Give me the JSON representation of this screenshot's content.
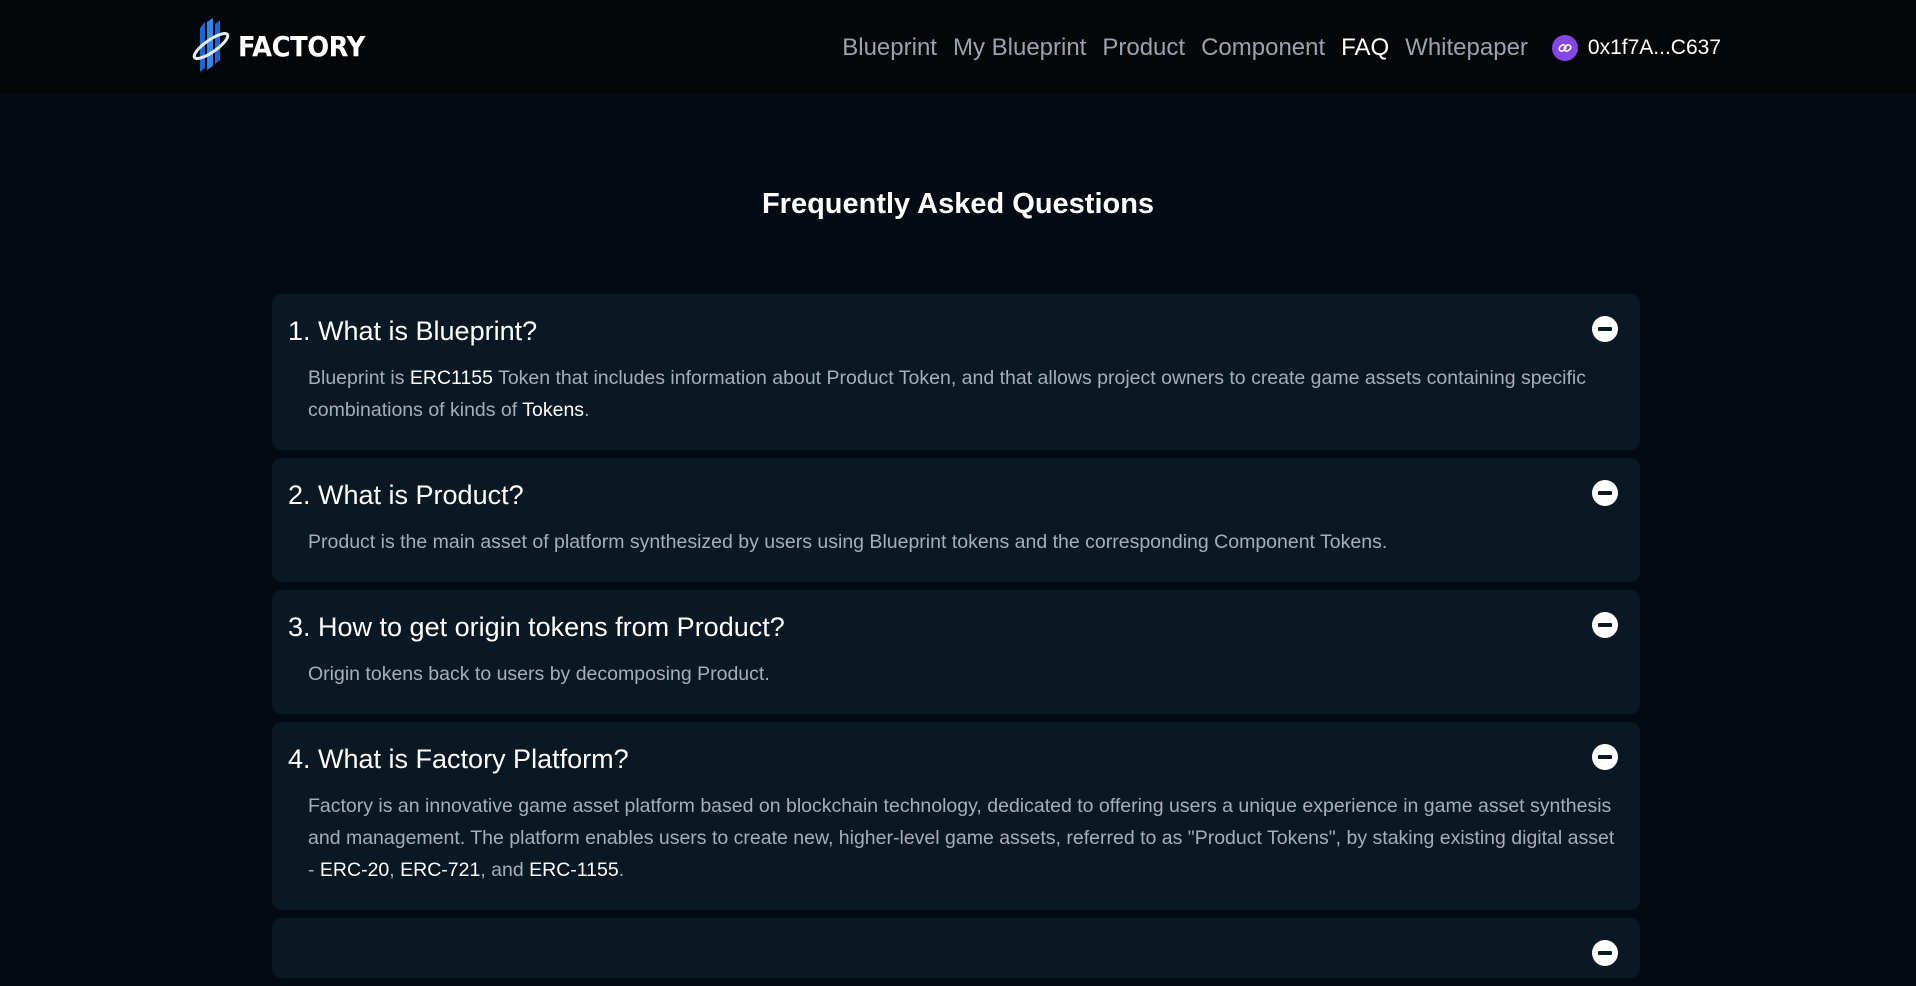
{
  "header": {
    "logo_text": "FACTORY",
    "nav": [
      {
        "label": "Blueprint",
        "active": false
      },
      {
        "label": "My Blueprint",
        "active": false
      },
      {
        "label": "Product",
        "active": false
      },
      {
        "label": "Component",
        "active": false
      },
      {
        "label": "FAQ",
        "active": true
      },
      {
        "label": "Whitepaper",
        "active": false
      }
    ],
    "wallet_address": "0x1f7A...C637",
    "wallet_icon": "polygon-link-icon"
  },
  "page_title": "Frequently Asked Questions",
  "faq": [
    {
      "question": "1. What is Blueprint?",
      "answer": {
        "p1": "Blueprint is ",
        "h1": "ERC1155",
        "p2": " Token that includes information about Product Token, and that allows project owners to create game assets containing specific combinations of kinds of ",
        "h2": "Tokens",
        "p3": "."
      }
    },
    {
      "question": "2. What is Product?",
      "answer": {
        "p1": "Product is the main asset of platform synthesized by users using Blueprint tokens and the corresponding Component Tokens."
      }
    },
    {
      "question": "3. How to get origin tokens from Product?",
      "answer": {
        "p1": "Origin tokens back to users by decomposing Product."
      }
    },
    {
      "question": "4. What is Factory Platform?",
      "answer": {
        "p1": "Factory is an innovative game asset platform based on blockchain technology, dedicated to offering users a unique experience in game asset synthesis and management. The platform enables users to create new, higher-level game assets, referred to as \"Product Tokens\", by staking existing digital asset - ",
        "h1": "ERC-20",
        "p2": ", ",
        "h2": "ERC-721",
        "p3": ", and ",
        "h3": "ERC-1155",
        "p4": "."
      }
    }
  ],
  "colors": {
    "background": "#050b13",
    "card": "#0a1824",
    "topbar": "#050608",
    "nav_text": "#9aa3ad",
    "answer_text": "#a7aeb6",
    "wallet_icon_bg": "#8247e5"
  }
}
